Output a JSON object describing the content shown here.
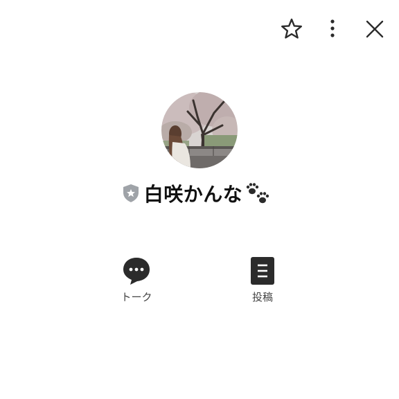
{
  "topbar": {
    "favorite_icon": "star-outline-icon",
    "more_icon": "more-vertical-icon",
    "close_icon": "close-icon"
  },
  "profile": {
    "name": "白咲かんな",
    "badge_icon": "shield-star-icon",
    "name_emoji": "paw-prints-icon",
    "avatar": "cherry-blossom-photo"
  },
  "actions": [
    {
      "label": "トーク",
      "icon": "chat-bubble-icon"
    },
    {
      "label": "投稿",
      "icon": "post-document-icon"
    }
  ],
  "colors": {
    "icon_dark": "#2b2b2b",
    "shield_gray": "#9fa3a8",
    "label_gray": "#444444"
  }
}
